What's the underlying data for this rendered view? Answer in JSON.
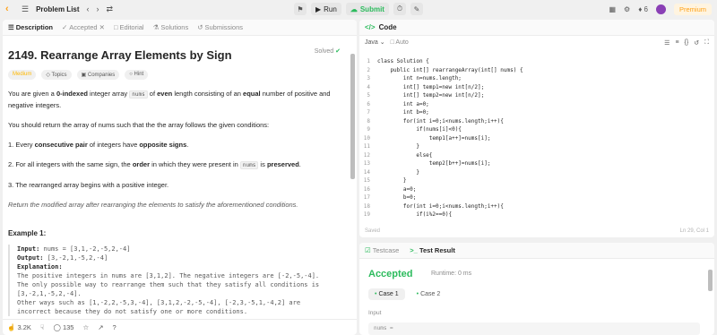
{
  "topbar": {
    "problem_list": "Problem List",
    "run_label": "Run",
    "submit_label": "Submit",
    "streak": "6",
    "premium": "Premium"
  },
  "left_tabs": [
    {
      "label": "Description"
    },
    {
      "label": "Accepted"
    },
    {
      "label": "Editorial"
    },
    {
      "label": "Solutions"
    },
    {
      "label": "Submissions"
    }
  ],
  "problem": {
    "title": "2149. Rearrange Array Elements by Sign",
    "status": "Solved",
    "difficulty": "Medium",
    "chips": [
      "Topics",
      "Companies",
      "Hint"
    ],
    "intro_1": "You are given a ",
    "intro_bold_1": "0-indexed",
    "intro_2": " integer array ",
    "intro_code": "nums",
    "intro_3": " of ",
    "intro_bold_2": "even",
    "intro_4": " length consisting of an ",
    "intro_bold_3": "equal",
    "intro_5": " number of positive and negative integers.",
    "task": "You should return the array of nums such that the the array follows the given conditions:",
    "cond1_a": "1. Every ",
    "cond1_b": "consecutive pair",
    "cond1_c": " of integers have ",
    "cond1_d": "opposite signs",
    "cond1_e": ".",
    "cond2_a": "2. For all integers with the same sign, the ",
    "cond2_b": "order",
    "cond2_c": " in which they were present in ",
    "cond2_code": "nums",
    "cond2_d": " is ",
    "cond2_e": "preserved",
    "cond2_f": ".",
    "cond3": "3. The rearranged array begins with a positive integer.",
    "ret": "Return the modified array after rearranging the elements to satisfy the aforementioned conditions.",
    "example_title": "Example 1:",
    "ex_input_label": "Input:",
    "ex_input": " nums = [3,1,-2,-5,2,-4]",
    "ex_output_label": "Output:",
    "ex_output": " [3,-2,1,-5,2,-4]",
    "ex_expl_label": "Explanation:",
    "ex_expl": [
      "The positive integers in nums are [3,1,2]. The negative integers are [-2,-5,-4].",
      "The only possible way to rearrange them such that they satisfy all conditions is",
      "[3,-2,1,-5,2,-4].",
      "Other ways such as [1,-2,2,-5,3,-4], [3,1,2,-2,-5,-4], [-2,3,-5,1,-4,2] are",
      "incorrect because they do not satisfy one or more conditions."
    ]
  },
  "footer": {
    "likes": "3.2K",
    "comments": "135"
  },
  "editor": {
    "header": "Code",
    "language": "Java",
    "mode": "Auto",
    "saved": "Saved",
    "position": "Ln 29, Col 1",
    "lines": [
      {
        "n": "1",
        "t": "class Solution {"
      },
      {
        "n": "2",
        "t": "    public int[] rearrangeArray(int[] nums) {"
      },
      {
        "n": "3",
        "t": "        int n=nums.length;"
      },
      {
        "n": "4",
        "t": "        int[] temp1=new int[n/2];"
      },
      {
        "n": "5",
        "t": "        int[] temp2=new int[n/2];"
      },
      {
        "n": "6",
        "t": "        int a=0;"
      },
      {
        "n": "7",
        "t": "        int b=0;"
      },
      {
        "n": "8",
        "t": "        for(int i=0;i<nums.length;i++){"
      },
      {
        "n": "9",
        "t": "            if(nums[i]<0){"
      },
      {
        "n": "10",
        "t": "                temp1[a++]=nums[i];"
      },
      {
        "n": "11",
        "t": "            }"
      },
      {
        "n": "12",
        "t": "            else{"
      },
      {
        "n": "13",
        "t": "                temp2[b++]=nums[i];"
      },
      {
        "n": "14",
        "t": "            }"
      },
      {
        "n": "15",
        "t": "        }"
      },
      {
        "n": "16",
        "t": "        a=0;"
      },
      {
        "n": "17",
        "t": "        b=0;"
      },
      {
        "n": "18",
        "t": "        for(int i=0;i<nums.length;i++){"
      },
      {
        "n": "19",
        "t": "            if(i%2==0){"
      }
    ]
  },
  "results": {
    "tab_testcase": "Testcase",
    "tab_result": "Test Result",
    "status": "Accepted",
    "runtime": "Runtime: 0 ms",
    "case1": "Case 1",
    "case2": "Case 2",
    "input_label": "Input",
    "input_value": "nums ="
  },
  "colors": {
    "accent": "#ffa116",
    "success": "#2cbb5d"
  }
}
